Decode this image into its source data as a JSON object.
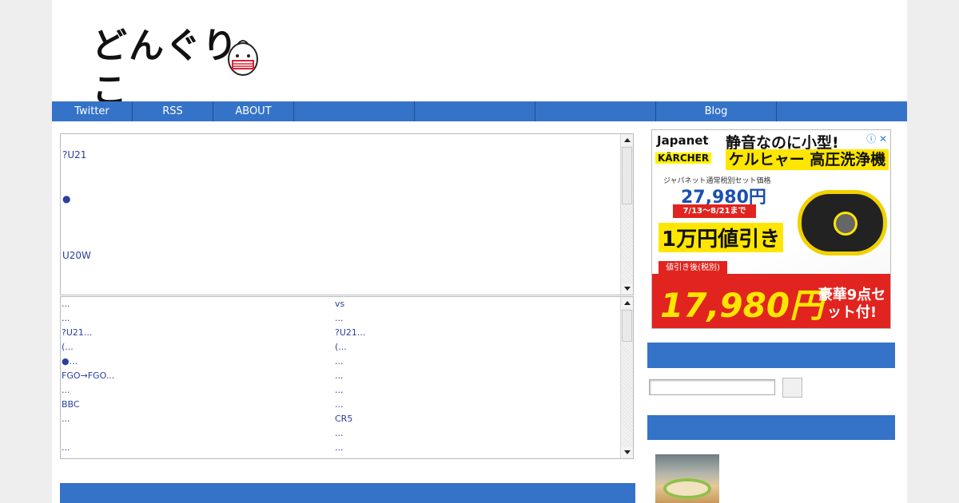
{
  "site": {
    "logo_text": "どんぐりこ"
  },
  "nav": {
    "items": [
      {
        "label": "Twitter"
      },
      {
        "label": "RSS"
      },
      {
        "label": "ABOUT"
      },
      {
        "label": ""
      },
      {
        "label": ""
      },
      {
        "label": ""
      },
      {
        "label": "Blog"
      },
      {
        "label": ""
      }
    ]
  },
  "frame_top": {
    "lines": [
      "?U21",
      "●",
      "U20W"
    ]
  },
  "frame_list": {
    "col_a": [
      "...",
      "...",
      "?U21...",
      "(...",
      "●...",
      "FGO→FGO...",
      "...",
      "BBC",
      "...",
      "",
      "..."
    ],
    "col_b": [
      "vs",
      "...",
      "?U21...",
      "(...",
      "...",
      "...",
      "...",
      "...",
      "CR5",
      "...",
      "..."
    ]
  },
  "ad": {
    "brand": "Japanet",
    "partner": "KÄRCHER",
    "headline1": "静音なのに小型!",
    "headline2": "ケルヒャー 高圧洗浄機",
    "price_label": "ジャパネット通常税別セット価格",
    "price_regular": "27,980円",
    "period": "7/13〜8/21まで",
    "discount": "1万円値引き",
    "after_label": "値引き後(税別)",
    "price_sale": "17,980円",
    "bonus": "豪華9点セット付!",
    "close": "ⓘ ✕"
  },
  "colors": {
    "accent": "#3573c8",
    "link": "#2a3f9e",
    "ad_red": "#e1241f",
    "ad_yellow": "#ffe600"
  }
}
